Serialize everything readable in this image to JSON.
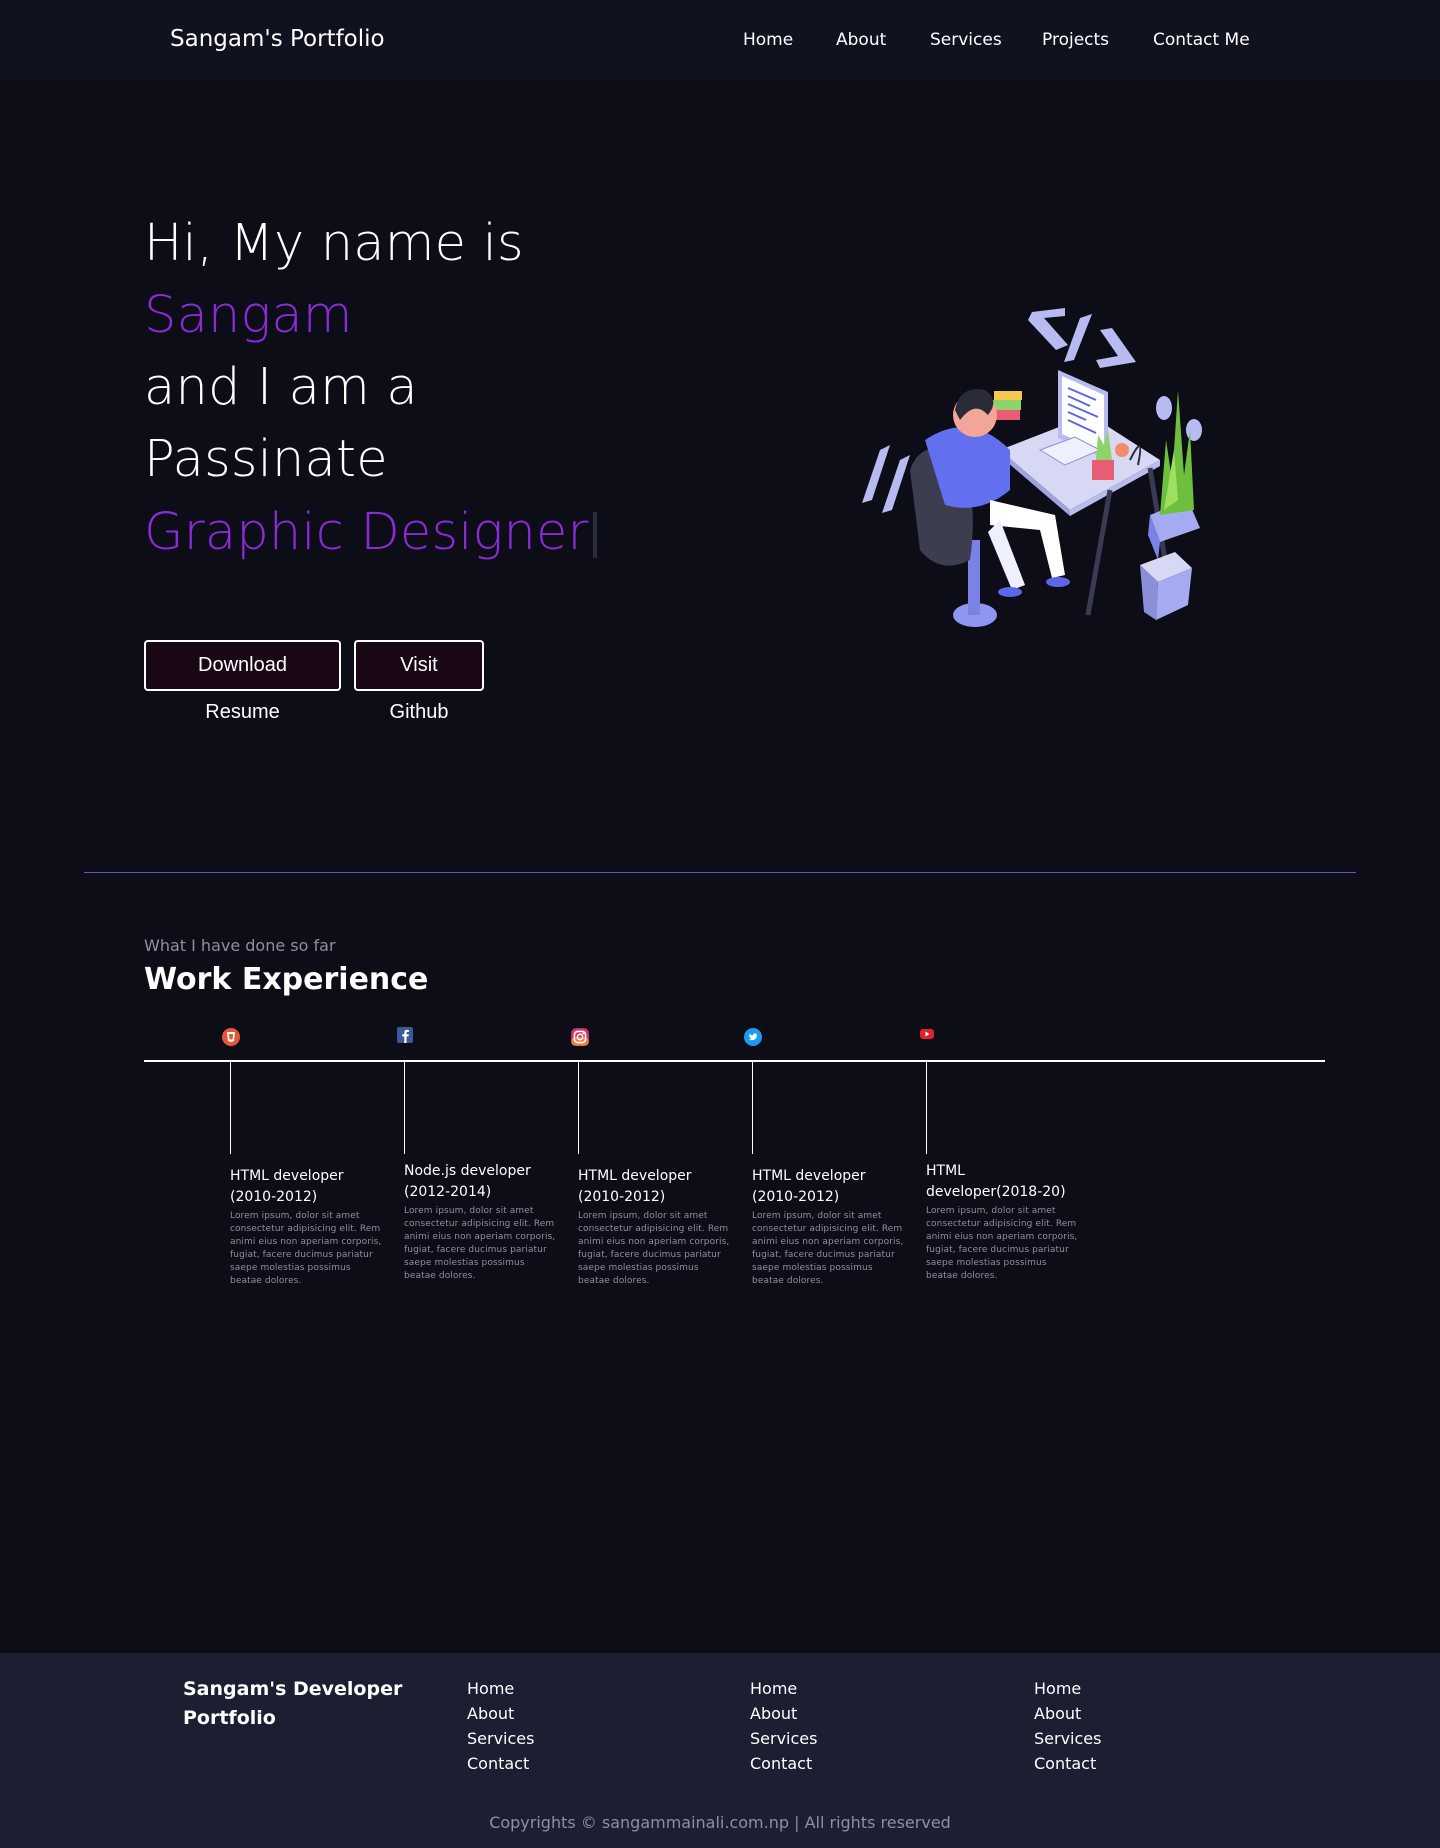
{
  "nav": {
    "brand": "Sangam's Portfolio",
    "links": [
      "Home",
      "About",
      "Services",
      "Projects",
      "Contact Me"
    ]
  },
  "hero": {
    "lines": [
      "Hi, My name is",
      "Sangam",
      "and I am a",
      "Passinate",
      "Graphic Designer"
    ],
    "accent_color": "#8a2bd6",
    "buttons": {
      "resume": "Download Resume",
      "github": "Visit Github"
    }
  },
  "work": {
    "subtitle": "What I have done so far",
    "title": "Work Experience",
    "items": [
      {
        "icon": "html5-icon",
        "title": "HTML developer (2010-2012)",
        "desc": "Lorem ipsum, dolor sit amet consectetur adipisicing elit. Rem animi eius non aperiam corporis, fugiat, facere ducimus pariatur saepe molestias possimus beatae dolores."
      },
      {
        "icon": "facebook-icon",
        "title": "Node.js developer (2012-2014)",
        "desc": "Lorem ipsum, dolor sit amet consectetur adipisicing elit. Rem animi eius non aperiam corporis, fugiat, facere ducimus pariatur saepe molestias possimus beatae dolores."
      },
      {
        "icon": "instagram-icon",
        "title": "HTML developer (2010-2012)",
        "desc": "Lorem ipsum, dolor sit amet consectetur adipisicing elit. Rem animi eius non aperiam corporis, fugiat, facere ducimus pariatur saepe molestias possimus beatae dolores."
      },
      {
        "icon": "twitter-icon",
        "title": "HTML developer (2010-2012)",
        "desc": "Lorem ipsum, dolor sit amet consectetur adipisicing elit. Rem animi eius non aperiam corporis, fugiat, facere ducimus pariatur saepe molestias possimus beatae dolores."
      },
      {
        "icon": "youtube-icon",
        "title": "HTML developer(2018-20)",
        "desc": "Lorem ipsum, dolor sit amet consectetur adipisicing elit. Rem animi eius non aperiam corporis, fugiat, facere ducimus pariatur saepe molestias possimus beatae dolores."
      }
    ]
  },
  "footer": {
    "brand": "Sangam's Developer Portfolio",
    "columns": [
      [
        "Home",
        "About",
        "Services",
        "Contact"
      ],
      [
        "Home",
        "About",
        "Services",
        "Contact"
      ],
      [
        "Home",
        "About",
        "Services",
        "Contact"
      ]
    ],
    "copyright": "Copyrights © sangammainali.com.np | All rights reserved"
  }
}
